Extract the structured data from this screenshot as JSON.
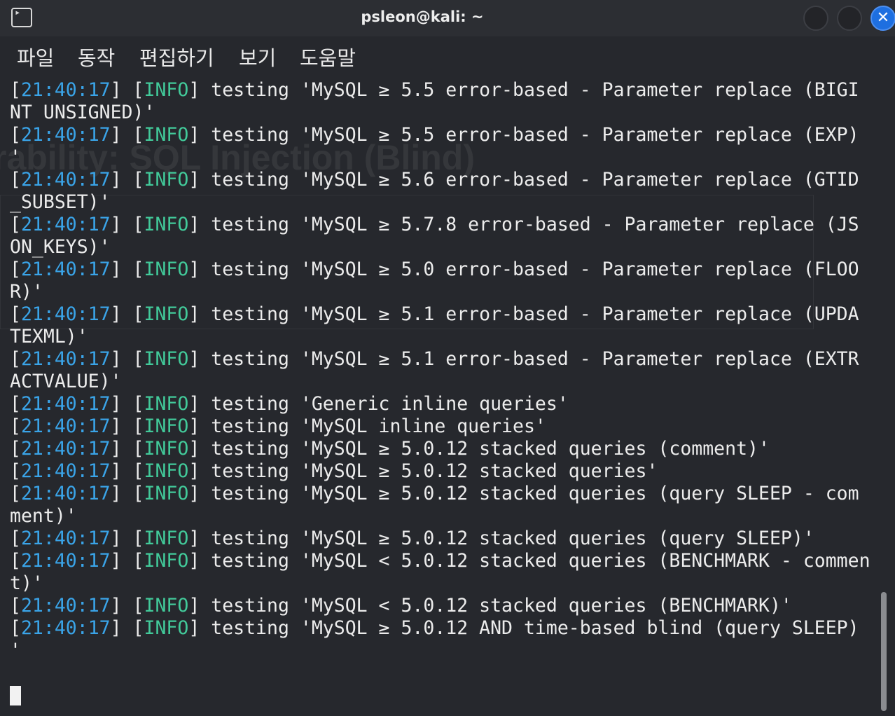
{
  "window": {
    "title": "psleon@kali: ~",
    "accent_color": "#1e6fe0"
  },
  "menu": {
    "items": [
      {
        "label": "파일"
      },
      {
        "label": "동작"
      },
      {
        "label": "편집하기"
      },
      {
        "label": "보기"
      },
      {
        "label": "도움말"
      }
    ]
  },
  "terminal": {
    "timestamp_color": "#3aa4e8",
    "level_color": "#42ca9a",
    "lines": [
      {
        "ts": "21:40:17",
        "lvl": "INFO",
        "text": " testing 'MySQL ≥ 5.5 error-based - Parameter replace (BIGI"
      },
      {
        "ts": "",
        "lvl": "",
        "text": "NT UNSIGNED)'"
      },
      {
        "ts": "21:40:17",
        "lvl": "INFO",
        "text": " testing 'MySQL ≥ 5.5 error-based - Parameter replace (EXP)"
      },
      {
        "ts": "",
        "lvl": "",
        "text": "'"
      },
      {
        "ts": "21:40:17",
        "lvl": "INFO",
        "text": " testing 'MySQL ≥ 5.6 error-based - Parameter replace (GTID"
      },
      {
        "ts": "",
        "lvl": "",
        "text": "_SUBSET)'"
      },
      {
        "ts": "21:40:17",
        "lvl": "INFO",
        "text": " testing 'MySQL ≥ 5.7.8 error-based - Parameter replace (JS"
      },
      {
        "ts": "",
        "lvl": "",
        "text": "ON_KEYS)'"
      },
      {
        "ts": "21:40:17",
        "lvl": "INFO",
        "text": " testing 'MySQL ≥ 5.0 error-based - Parameter replace (FLOO"
      },
      {
        "ts": "",
        "lvl": "",
        "text": "R)'"
      },
      {
        "ts": "21:40:17",
        "lvl": "INFO",
        "text": " testing 'MySQL ≥ 5.1 error-based - Parameter replace (UPDA"
      },
      {
        "ts": "",
        "lvl": "",
        "text": "TEXML)'"
      },
      {
        "ts": "21:40:17",
        "lvl": "INFO",
        "text": " testing 'MySQL ≥ 5.1 error-based - Parameter replace (EXTR"
      },
      {
        "ts": "",
        "lvl": "",
        "text": "ACTVALUE)'"
      },
      {
        "ts": "21:40:17",
        "lvl": "INFO",
        "text": " testing 'Generic inline queries'"
      },
      {
        "ts": "21:40:17",
        "lvl": "INFO",
        "text": " testing 'MySQL inline queries'"
      },
      {
        "ts": "21:40:17",
        "lvl": "INFO",
        "text": " testing 'MySQL ≥ 5.0.12 stacked queries (comment)'"
      },
      {
        "ts": "21:40:17",
        "lvl": "INFO",
        "text": " testing 'MySQL ≥ 5.0.12 stacked queries'"
      },
      {
        "ts": "21:40:17",
        "lvl": "INFO",
        "text": " testing 'MySQL ≥ 5.0.12 stacked queries (query SLEEP - com"
      },
      {
        "ts": "",
        "lvl": "",
        "text": "ment)'"
      },
      {
        "ts": "21:40:17",
        "lvl": "INFO",
        "text": " testing 'MySQL ≥ 5.0.12 stacked queries (query SLEEP)'"
      },
      {
        "ts": "21:40:17",
        "lvl": "INFO",
        "text": " testing 'MySQL < 5.0.12 stacked queries (BENCHMARK - commen"
      },
      {
        "ts": "",
        "lvl": "",
        "text": "t)'"
      },
      {
        "ts": "21:40:17",
        "lvl": "INFO",
        "text": " testing 'MySQL < 5.0.12 stacked queries (BENCHMARK)'"
      },
      {
        "ts": "21:40:17",
        "lvl": "INFO",
        "text": " testing 'MySQL ≥ 5.0.12 AND time-based blind (query SLEEP)"
      },
      {
        "ts": "",
        "lvl": "",
        "text": "'"
      }
    ]
  },
  "background_ghost": {
    "heading": "rability: SQL Injection (Blind)"
  }
}
